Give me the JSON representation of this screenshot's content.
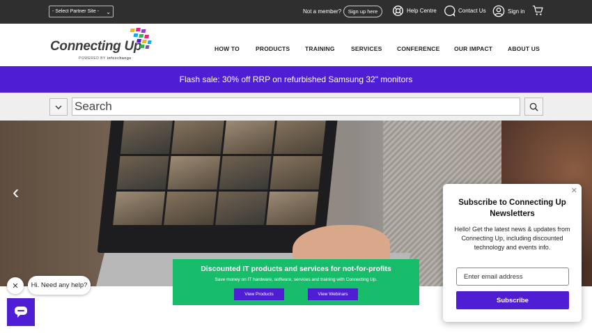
{
  "topbar": {
    "partner_select": "- Select Partner Site -",
    "not_member": "Not a member?",
    "signup": "Sign up here",
    "help": "Help Centre",
    "contact": "Contact Us",
    "signin": "Sign in"
  },
  "logo": {
    "name": "Connecting Up",
    "powered_by": "POWERED BY",
    "partner": "infoxchange"
  },
  "nav": [
    "HOW TO",
    "PRODUCTS",
    "TRAINING",
    "SERVICES",
    "CONFERENCE",
    "OUR IMPACT",
    "ABOUT US"
  ],
  "flash": {
    "text": "Flash sale: 30% off RRP on refurbished Samsung 32\" monitors"
  },
  "search": {
    "placeholder": "Search"
  },
  "promo": {
    "title": "Discounted IT products and services for not-for-profits",
    "subtitle": "Save money on IT hardware, software, services and training with Connecting Up.",
    "btn_products": "View Products",
    "btn_webinars": "View Webinars"
  },
  "chat": {
    "greeting": "Hi. Need any help?"
  },
  "subscribe": {
    "title": "Subscribe to Connecting Up Newsletters",
    "text": "Hello! Get the latest news & updates from Connecting Up, including discounted technology and events info.",
    "email_placeholder": "Enter email address",
    "button": "Subscribe"
  },
  "colors": {
    "brand_purple": "#4f1ed4",
    "promo_green": "#17bd6b",
    "topbar": "#2f2f2f"
  }
}
